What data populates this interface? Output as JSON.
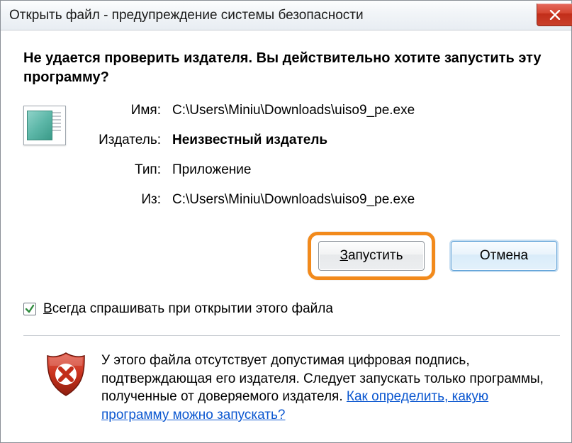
{
  "titlebar": {
    "title": "Открыть файл - предупреждение системы безопасности"
  },
  "heading": "Не удается проверить издателя.  Вы действительно хотите запустить эту программу?",
  "fields": {
    "name_label": "Имя:",
    "name_value": "C:\\Users\\Miniu\\Downloads\\uiso9_pe.exe",
    "publisher_label": "Издатель:",
    "publisher_value": "Неизвестный издатель",
    "type_label": "Тип:",
    "type_value": "Приложение",
    "from_label": "Из:",
    "from_value": "C:\\Users\\Miniu\\Downloads\\uiso9_pe.exe"
  },
  "buttons": {
    "run_prefix": "З",
    "run_rest": "апустить",
    "cancel": "Отмена"
  },
  "checkbox": {
    "checked": true,
    "label_prefix": "В",
    "label_rest": "сегда спрашивать при открытии этого файла"
  },
  "footer": {
    "text": "У этого файла отсутствует допустимая цифровая подпись, подтверждающая его издателя.  Следует запускать только программы, полученные от доверяемого издателя.  ",
    "link": "Как определить, какую программу можно запускать?"
  }
}
